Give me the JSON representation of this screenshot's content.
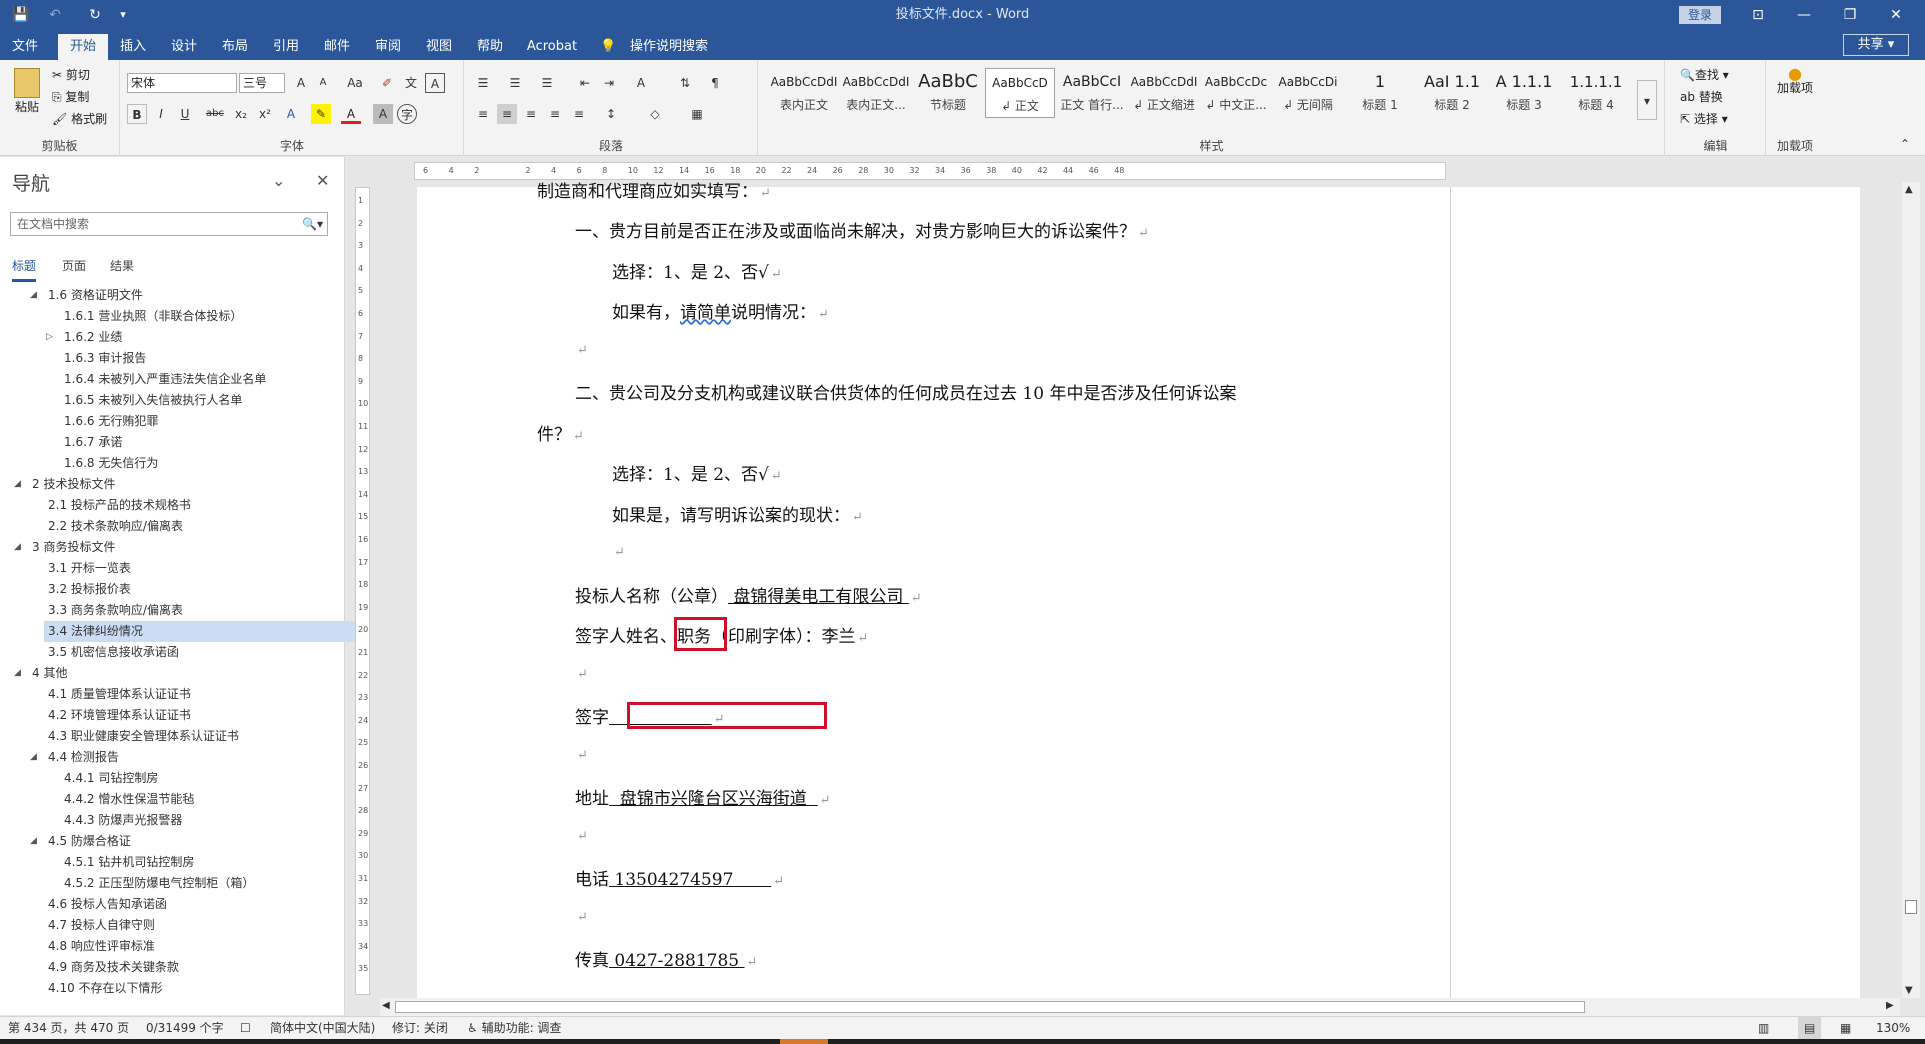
{
  "window": {
    "title": "投标文件.docx  -  Word",
    "login": "登录",
    "quick_access": {
      "save": "💾",
      "undo": "↶",
      "redo": "↻",
      "customize": "▾"
    },
    "controls": {
      "ribbon_display": "⊡",
      "minimize": "—",
      "restore": "❐",
      "close": "✕"
    }
  },
  "tabs": [
    "文件",
    "开始",
    "插入",
    "设计",
    "布局",
    "引用",
    "邮件",
    "审阅",
    "视图",
    "帮助",
    "Acrobat",
    "操作说明搜索"
  ],
  "share": "共享",
  "ribbon": {
    "clipboard": {
      "label": "剪贴板",
      "paste": "粘贴",
      "cut": "剪切",
      "copy": "复制",
      "format_painter": "格式刷"
    },
    "font": {
      "label": "字体",
      "font_name": "宋体",
      "font_size": "三号",
      "bold": "B",
      "italic": "I",
      "underline": "U",
      "strike": "abc",
      "subscript": "x₂",
      "superscript": "x²",
      "grow": "A",
      "shrink": "A",
      "case": "Aa",
      "clear": "✐",
      "phonetic": "文",
      "border": "A",
      "effect": "A",
      "highlight": "✎",
      "color": "A",
      "shade": "A",
      "enclose": "字"
    },
    "paragraph": {
      "label": "段落",
      "bullets": "☰",
      "numbering": "☰",
      "multilevel": "☰",
      "dec_indent": "⇤",
      "inc_indent": "⇥",
      "cjk": "A",
      "sort": "⇅",
      "marks": "¶",
      "align_left": "≡",
      "align_center": "≡",
      "align_right": "≡",
      "justify": "≡",
      "distribute": "≡",
      "line_spacing": "↕",
      "shading": "◇",
      "borders": "▦"
    },
    "styles": {
      "label": "样式",
      "items": [
        {
          "sample": "AaBbCcDdI",
          "name": "表内正文"
        },
        {
          "sample": "AaBbCcDdI",
          "name": "表内正文..."
        },
        {
          "sample": "AaBbC",
          "name": "节标题"
        },
        {
          "sample": "AaBbCcD",
          "name": "↲ 正文"
        },
        {
          "sample": "AaBbCcI",
          "name": "正文 首行..."
        },
        {
          "sample": "AaBbCcDdI",
          "name": "↲ 正文缩进"
        },
        {
          "sample": "AaBbCcDc",
          "name": "↲ 中文正..."
        },
        {
          "sample": "AaBbCcDi",
          "name": "↲ 无间隔"
        },
        {
          "sample": "1",
          "name": "标题 1"
        },
        {
          "sample": "AaI  1.1",
          "name": "标题 2"
        },
        {
          "sample": "A  1.1.1",
          "name": "标题 3"
        },
        {
          "sample": "1.1.1.1",
          "name": "标题 4"
        }
      ]
    },
    "editing": {
      "label": "编辑",
      "find": "查找",
      "replace": "替换",
      "select": "选择"
    },
    "addins": {
      "label": "加载项",
      "button": "加载项"
    }
  },
  "nav": {
    "title": "导航",
    "search_placeholder": "在文档中搜索",
    "tabs": [
      "标题",
      "页面",
      "结果"
    ],
    "items": [
      {
        "text": "1.6 资格证明文件",
        "level": 1,
        "arrow": "◢"
      },
      {
        "text": "1.6.1 营业执照（非联合体投标）",
        "level": 2,
        "arrow": ""
      },
      {
        "text": "1.6.2 业绩",
        "level": 2,
        "arrow": "▷"
      },
      {
        "text": "1.6.3 审计报告",
        "level": 2,
        "arrow": ""
      },
      {
        "text": "1.6.4 未被列入严重违法失信企业名单",
        "level": 2,
        "arrow": ""
      },
      {
        "text": "1.6.5 未被列入失信被执行人名单",
        "level": 2,
        "arrow": ""
      },
      {
        "text": "1.6.6 无行贿犯罪",
        "level": 2,
        "arrow": ""
      },
      {
        "text": "1.6.7 承诺",
        "level": 2,
        "arrow": ""
      },
      {
        "text": "1.6.8 无失信行为",
        "level": 2,
        "arrow": ""
      },
      {
        "text": "2 技术投标文件",
        "level": 0,
        "arrow": "◢"
      },
      {
        "text": "2.1 投标产品的技术规格书",
        "level": 1,
        "arrow": ""
      },
      {
        "text": "2.2 技术条款响应/偏离表",
        "level": 1,
        "arrow": ""
      },
      {
        "text": "3 商务投标文件",
        "level": 0,
        "arrow": "◢"
      },
      {
        "text": "3.1 开标一览表",
        "level": 1,
        "arrow": ""
      },
      {
        "text": "3.2 投标报价表",
        "level": 1,
        "arrow": ""
      },
      {
        "text": "3.3 商务条款响应/偏离表",
        "level": 1,
        "arrow": ""
      },
      {
        "text": "3.4 法律纠纷情况",
        "level": 1,
        "arrow": "",
        "selected": true
      },
      {
        "text": "3.5 机密信息接收承诺函",
        "level": 1,
        "arrow": ""
      },
      {
        "text": "4 其他",
        "level": 0,
        "arrow": "◢"
      },
      {
        "text": "4.1 质量管理体系认证证书",
        "level": 1,
        "arrow": ""
      },
      {
        "text": "4.2 环境管理体系认证证书",
        "level": 1,
        "arrow": ""
      },
      {
        "text": "4.3 职业健康安全管理体系认证证书",
        "level": 1,
        "arrow": ""
      },
      {
        "text": "4.4 检测报告",
        "level": 1,
        "arrow": "◢"
      },
      {
        "text": "4.4.1 司钻控制房",
        "level": 2,
        "arrow": ""
      },
      {
        "text": "4.4.2 憎水性保温节能毡",
        "level": 2,
        "arrow": ""
      },
      {
        "text": "4.4.3 防爆声光报警器",
        "level": 2,
        "arrow": ""
      },
      {
        "text": "4.5 防爆合格证",
        "level": 1,
        "arrow": "◢"
      },
      {
        "text": "4.5.1 钻井机司钻控制房",
        "level": 2,
        "arrow": ""
      },
      {
        "text": "4.5.2 正压型防爆电气控制柜（箱）",
        "level": 2,
        "arrow": ""
      },
      {
        "text": "4.6 投标人告知承诺函",
        "level": 1,
        "arrow": ""
      },
      {
        "text": "4.7 投标人自律守则",
        "level": 1,
        "arrow": ""
      },
      {
        "text": "4.8 响应性评审标准",
        "level": 1,
        "arrow": ""
      },
      {
        "text": "4.9 商务及技术关键条款",
        "level": 1,
        "arrow": ""
      },
      {
        "text": "4.10 不存在以下情形",
        "level": 1,
        "arrow": ""
      }
    ]
  },
  "ruler": {
    "h_ticks": [
      "6",
      "4",
      "2",
      "",
      "2",
      "4",
      "6",
      "8",
      "10",
      "12",
      "14",
      "16",
      "18",
      "20",
      "22",
      "24",
      "26",
      "28",
      "30",
      "32",
      "34",
      "36",
      "38",
      "40",
      "42",
      "44",
      "46",
      "48"
    ],
    "v_ticks": [
      "1",
      "2",
      "3",
      "4",
      "5",
      "6",
      "7",
      "8",
      "9",
      "10",
      "11",
      "12",
      "13",
      "14",
      "15",
      "16",
      "17",
      "18",
      "19",
      "20",
      "21",
      "22",
      "23",
      "24",
      "25",
      "26",
      "27",
      "28",
      "29",
      "30",
      "31",
      "32",
      "33",
      "34",
      "35"
    ]
  },
  "document": {
    "line1": "制造商和代理商应如实填写：",
    "q1": "一、贵方目前是否正在涉及或面临尚未解决，对贵方影响巨大的诉讼案件？",
    "q1_choice": "选择：1、是        2、否√",
    "q1_detail_prefix": "如果有，",
    "q1_detail_wavy": "请简单",
    "q1_detail_suffix": "说明情况：",
    "q2_line1": "二、贵公司及分支机构或建议联合供货体的任何成员在过去 10 年中是否涉及任何诉讼案",
    "q2_line2": "件？",
    "q2_choice": "选择：1、是        2、否√",
    "q2_detail": "如果是，请写明诉讼案的现状：",
    "bidder_label": "投标人名称（公章）",
    "bidder_value": "  盘锦得美电工有限公司  ",
    "signer_prefix": "签字人姓名、",
    "signer_boxed": "职务",
    "signer_suffix": "（印刷字体）：李兰",
    "sign_label": "签字",
    "sign_blank": "                   ",
    "address_label": "地址",
    "address_value": "  盘锦市兴隆台区兴海街道  ",
    "phone_label": "电话",
    "phone_value": " 13504274597       ",
    "fax_label": "传真",
    "fax_value": " 0427-2881785 ",
    "mark": "↵"
  },
  "status": {
    "page": "第 434 页，共 470 页",
    "words": "0/31499 个字",
    "proof": "☐",
    "language": "简体中文(中国大陆)",
    "track": "修订: 关闭",
    "accessibility": "辅助功能: 调查",
    "zoom": "130%"
  },
  "colors": {
    "accent": "#2b579a",
    "highlight_box": "#d0102a",
    "nav_selected": "#cbdcf5"
  }
}
